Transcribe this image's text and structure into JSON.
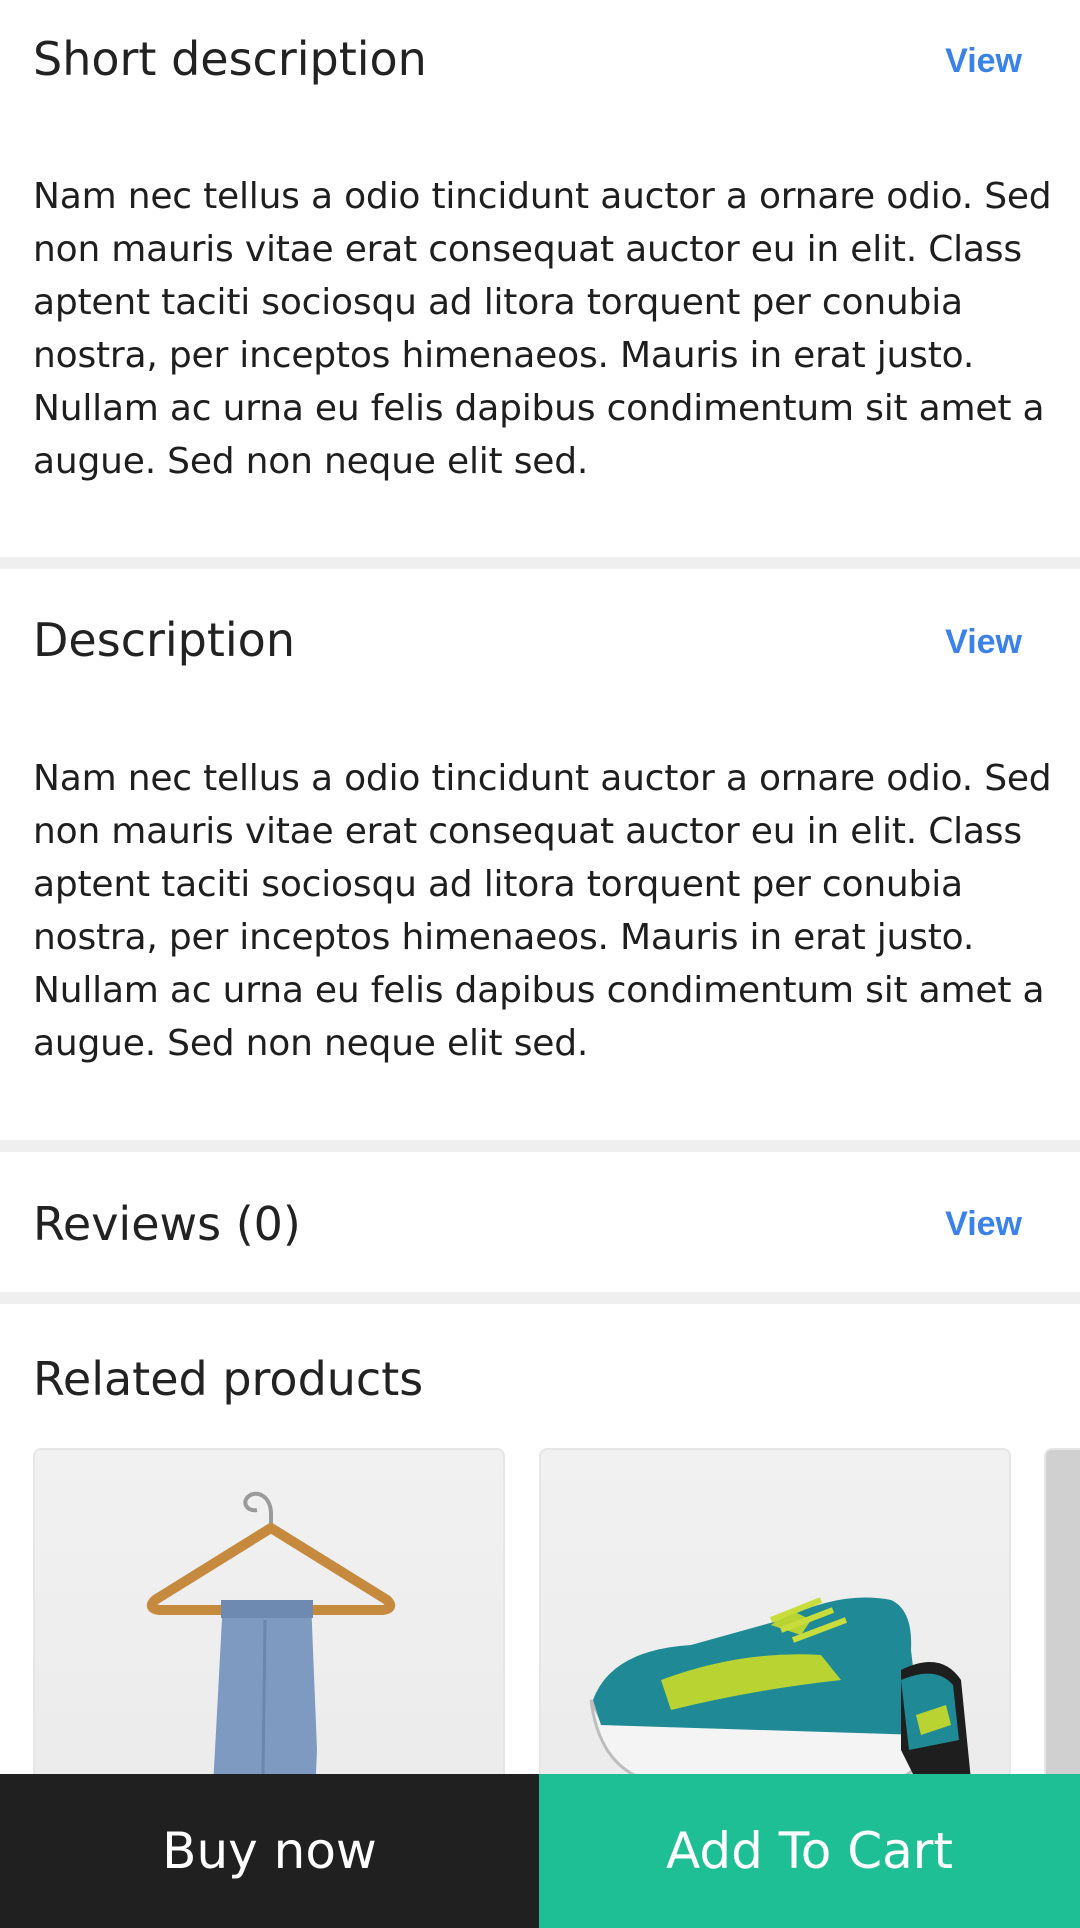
{
  "sections": {
    "short_description": {
      "title": "Short description",
      "view_label": "View",
      "body": "Nam nec tellus a odio tincidunt auctor a ornare odio. Sed non mauris vitae erat consequat auctor eu in elit. Class aptent taciti sociosqu ad litora torquent per conubia nostra, per inceptos himenaeos. Mauris in erat justo. Nullam ac urna eu felis dapibus condimentum sit amet a augue. Sed non neque elit sed."
    },
    "description": {
      "title": "Description",
      "view_label": "View",
      "body": "Nam nec tellus a odio tincidunt auctor a ornare odio. Sed non mauris vitae erat consequat auctor eu in elit. Class aptent taciti sociosqu ad litora torquent per conubia nostra, per inceptos himenaeos. Mauris in erat justo. Nullam ac urna eu felis dapibus condimentum sit amet a augue. Sed non neque elit sed."
    },
    "reviews": {
      "title": "Reviews (0)",
      "view_label": "View"
    }
  },
  "related": {
    "title": "Related products",
    "products": [
      {
        "image": "hanger-with-jeans"
      },
      {
        "image": "teal-running-shoes"
      },
      {
        "image": "partial-product"
      }
    ]
  },
  "actions": {
    "buy_now_label": "Buy now",
    "add_to_cart_label": "Add To Cart"
  },
  "colors": {
    "link": "#3b82e8",
    "buy_now_bg": "#202020",
    "add_to_cart_bg": "#1fbf96",
    "divider": "#efefef"
  }
}
